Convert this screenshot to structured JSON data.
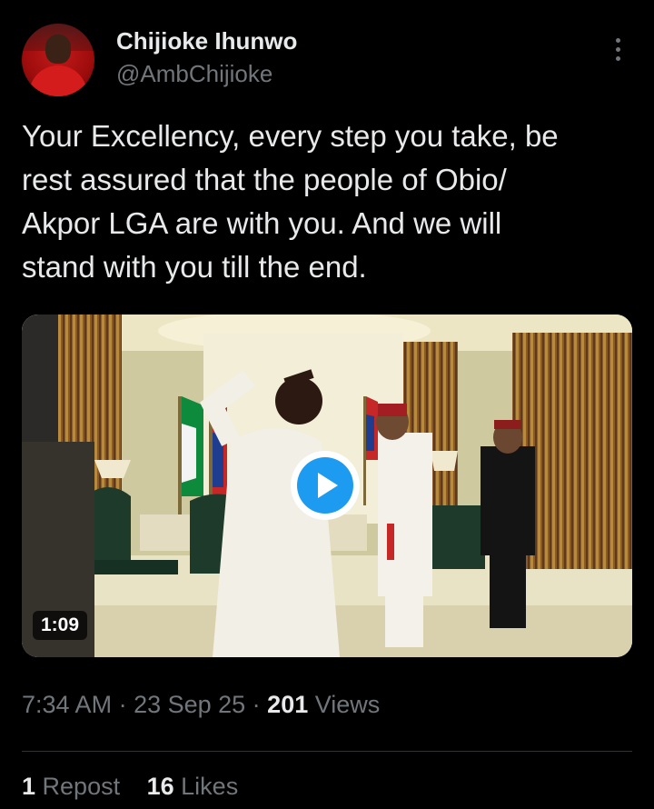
{
  "author": {
    "display_name": "Chijioke Ihunwo",
    "handle": "@AmbChijioke"
  },
  "tweet": {
    "text": "Your Excellency, every step you take, be\nrest assured that the people of Obio/\nAkpor LGA are with you. And we will\nstand with you till the end."
  },
  "media": {
    "type": "video",
    "duration": "1:09",
    "play_icon": "play-icon",
    "colors": {
      "play_button": "#1d9bf0"
    }
  },
  "meta": {
    "time": "7:34 AM",
    "sep1": " · ",
    "date": "23 Sep 25",
    "sep2": " · ",
    "views_count": "201",
    "views_label": " Views"
  },
  "stats": {
    "reposts_count": "1",
    "reposts_label": " Repost",
    "likes_count": "16",
    "likes_label": " Likes"
  },
  "icons": {
    "more": "more-vertical-icon"
  }
}
